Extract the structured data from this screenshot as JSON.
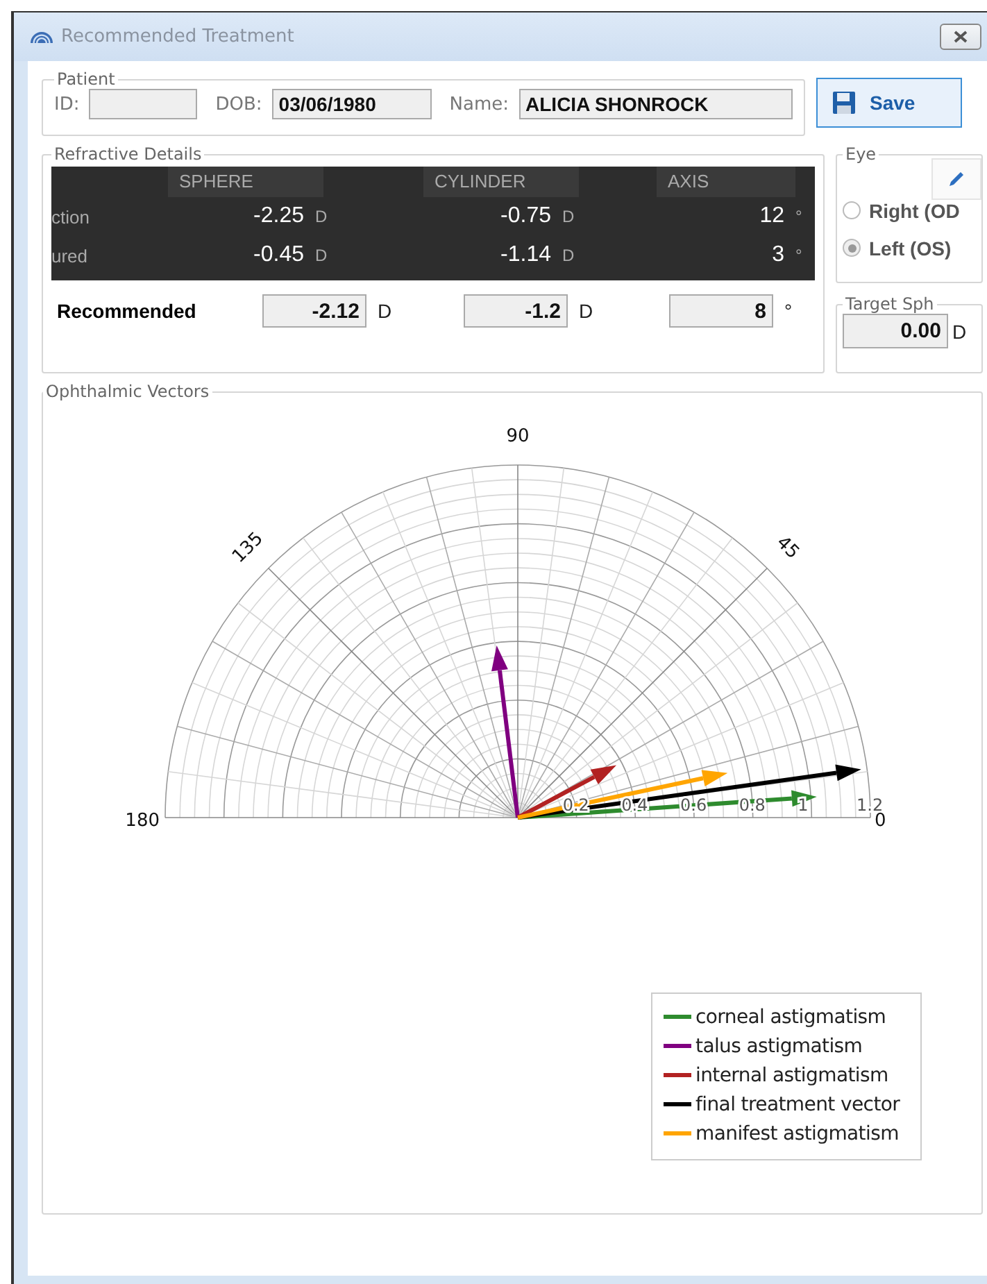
{
  "window": {
    "title": "Recommended Treatment"
  },
  "patient": {
    "title": "Patient",
    "id_label": "ID:",
    "dob_label": "DOB:",
    "dob_value": "03/06/1980",
    "name_label": "Name:",
    "name_value": "ALICIA SHONROCK"
  },
  "save_button": {
    "label": "Save"
  },
  "refractive": {
    "title": "Refractive Details",
    "columns": [
      "SPHERE",
      "CYLINDER",
      "AXIS"
    ],
    "rows": [
      {
        "label": "ction",
        "cells": [
          {
            "value": "-2.25",
            "unit": "D"
          },
          {
            "value": "-0.75",
            "unit": "D"
          },
          {
            "value": "12",
            "unit": "°"
          }
        ]
      },
      {
        "label": "ured",
        "cells": [
          {
            "value": "-0.45",
            "unit": "D"
          },
          {
            "value": "-1.14",
            "unit": "D"
          },
          {
            "value": "3",
            "unit": "°"
          }
        ]
      }
    ],
    "recommended": {
      "label": "Recommended",
      "cells": [
        {
          "value": "-2.12",
          "unit": "D"
        },
        {
          "value": "-1.2",
          "unit": "D"
        },
        {
          "value": "8",
          "unit": "°"
        }
      ]
    }
  },
  "eye": {
    "title": "Eye",
    "options": [
      {
        "label": "Right (OD",
        "selected": false
      },
      {
        "label": "Left (OS)",
        "selected": true
      }
    ]
  },
  "target_sph": {
    "title": "Target Sph",
    "value": "0.00",
    "unit": "D"
  },
  "vectors": {
    "title": "Ophthalmic Vectors",
    "angle_labels": [
      "0",
      "45",
      "90",
      "135",
      "180"
    ],
    "radius_labels": [
      "0.2",
      "0.4",
      "0.6",
      "0.8",
      "1",
      "1.2"
    ],
    "legend": [
      {
        "label": "corneal astigmatism",
        "color": "#2e8b2e"
      },
      {
        "label": "talus astigmatism",
        "color": "#800080"
      },
      {
        "label": "internal astigmatism",
        "color": "#b22222"
      },
      {
        "label": "final treatment vector",
        "color": "#000000"
      },
      {
        "label": "manifest astigmatism",
        "color": "#ffa500"
      }
    ]
  }
}
